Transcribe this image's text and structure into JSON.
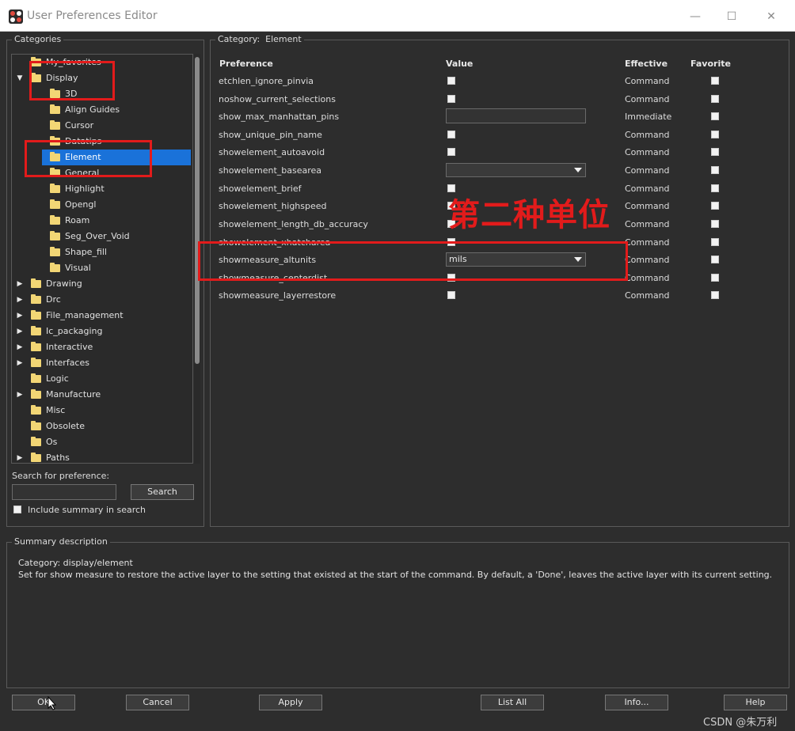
{
  "window": {
    "title": "User Preferences Editor",
    "minimize": "—",
    "maximize": "☐",
    "close": "✕"
  },
  "categories": {
    "title": "Categories",
    "tree": [
      {
        "label": "My_favorites",
        "expanded": false,
        "has_children": false,
        "level": 0
      },
      {
        "label": "Display",
        "expanded": true,
        "has_children": true,
        "level": 0
      },
      {
        "label": "3D",
        "level": 1
      },
      {
        "label": "Align Guides",
        "level": 1
      },
      {
        "label": "Cursor",
        "level": 1
      },
      {
        "label": "Datatips",
        "level": 1
      },
      {
        "label": "Element",
        "level": 1,
        "selected": true
      },
      {
        "label": "General",
        "level": 1
      },
      {
        "label": "Highlight",
        "level": 1
      },
      {
        "label": "Opengl",
        "level": 1
      },
      {
        "label": "Roam",
        "level": 1
      },
      {
        "label": "Seg_Over_Void",
        "level": 1
      },
      {
        "label": "Shape_fill",
        "level": 1
      },
      {
        "label": "Visual",
        "level": 1
      },
      {
        "label": "Drawing",
        "has_children": true,
        "level": 0
      },
      {
        "label": "Drc",
        "has_children": true,
        "level": 0
      },
      {
        "label": "File_management",
        "has_children": true,
        "level": 0
      },
      {
        "label": "Ic_packaging",
        "has_children": true,
        "level": 0
      },
      {
        "label": "Interactive",
        "has_children": true,
        "level": 0
      },
      {
        "label": "Interfaces",
        "has_children": true,
        "level": 0
      },
      {
        "label": "Logic",
        "has_children": false,
        "level": 0
      },
      {
        "label": "Manufacture",
        "has_children": true,
        "level": 0
      },
      {
        "label": "Misc",
        "has_children": false,
        "level": 0
      },
      {
        "label": "Obsolete",
        "has_children": false,
        "level": 0
      },
      {
        "label": "Os",
        "has_children": false,
        "level": 0
      },
      {
        "label": "Paths",
        "has_children": true,
        "level": 0
      }
    ],
    "search_label": "Search for preference:",
    "search_value": "",
    "search_button": "Search",
    "include_summary_label": "Include summary in search"
  },
  "category_panel": {
    "title_prefix": "Category:",
    "title_value": "Element",
    "headers": {
      "preference": "Preference",
      "value": "Value",
      "effective": "Effective",
      "favorite": "Favorite"
    },
    "rows": [
      {
        "name": "etchlen_ignore_pinvia",
        "value_type": "checkbox",
        "effective": "Command"
      },
      {
        "name": "noshow_current_selections",
        "value_type": "checkbox",
        "effective": "Command"
      },
      {
        "name": "show_max_manhattan_pins",
        "value_type": "text",
        "value": "",
        "effective": "Immediate"
      },
      {
        "name": "show_unique_pin_name",
        "value_type": "checkbox",
        "effective": "Command"
      },
      {
        "name": "showelement_autoavoid",
        "value_type": "checkbox",
        "effective": "Command"
      },
      {
        "name": "showelement_basearea",
        "value_type": "combo",
        "value": "",
        "effective": "Command"
      },
      {
        "name": "showelement_brief",
        "value_type": "checkbox",
        "effective": "Command"
      },
      {
        "name": "showelement_highspeed",
        "value_type": "checkbox",
        "effective": "Command"
      },
      {
        "name": "showelement_length_db_accuracy",
        "value_type": "checkbox",
        "effective": "Command"
      },
      {
        "name": "showelement_xhatcharea",
        "value_type": "checkbox",
        "effective": "Command"
      },
      {
        "name": "showmeasure_altunits",
        "value_type": "combo",
        "value": "mils",
        "effective": "Command"
      },
      {
        "name": "showmeasure_centerdist",
        "value_type": "checkbox",
        "effective": "Command"
      },
      {
        "name": "showmeasure_layerrestore",
        "value_type": "checkbox",
        "effective": "Command"
      }
    ]
  },
  "summary": {
    "title": "Summary description",
    "category_line": "Category: display/element",
    "description": "Set for show measure to restore the active layer to the setting that existed at the start of the command. By default, a 'Done', leaves the active layer with its current setting."
  },
  "buttons": {
    "ok": "OK",
    "cancel": "Cancel",
    "apply": "Apply",
    "list_all": "List All",
    "info": "Info...",
    "help": "Help"
  },
  "annotation": {
    "text": "第二种单位",
    "color": "#e21b1b"
  },
  "watermark": "CSDN @朱万利"
}
